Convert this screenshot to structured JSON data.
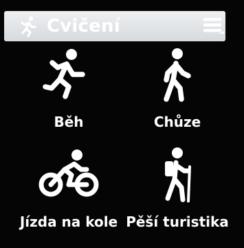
{
  "header": {
    "title": "Cvičení",
    "app_icon": "running-person-icon",
    "menu_icon": "menu-icon"
  },
  "activities": [
    {
      "label": "Běh",
      "icon": "running-icon"
    },
    {
      "label": "Chůze",
      "icon": "walking-icon"
    },
    {
      "label": "Jízda na kole",
      "icon": "cycling-icon"
    },
    {
      "label": "Pěší turistika",
      "icon": "hiking-icon"
    }
  ],
  "colors": {
    "background": "#050505",
    "header_bg": "#e4e7ea",
    "text": "#ffffff",
    "icon": "#ffffff"
  }
}
